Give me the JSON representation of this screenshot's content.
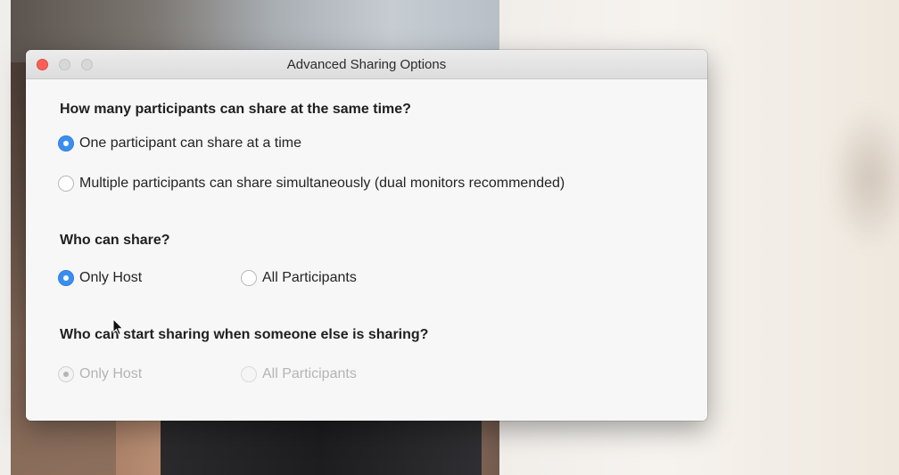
{
  "dialog": {
    "title": "Advanced Sharing Options"
  },
  "sections": [
    {
      "heading": "How many participants can share at the same time?",
      "options": [
        {
          "label": "One participant can share at a time",
          "selected": true
        },
        {
          "label": "Multiple participants can share simultaneously (dual monitors recommended)",
          "selected": false
        }
      ]
    },
    {
      "heading": "Who can share?",
      "options": [
        {
          "label": "Only Host",
          "selected": true
        },
        {
          "label": "All Participants",
          "selected": false
        }
      ]
    },
    {
      "heading": "Who can start sharing when someone else is sharing?",
      "options": [
        {
          "label": "Only Host",
          "selected": true,
          "disabled": true
        },
        {
          "label": "All Participants",
          "selected": false,
          "disabled": true
        }
      ]
    }
  ],
  "colors": {
    "accent": "#3b8ef0",
    "close_button": "#fc5f57"
  },
  "icons": {
    "cursor": "arrow-cursor-icon"
  }
}
